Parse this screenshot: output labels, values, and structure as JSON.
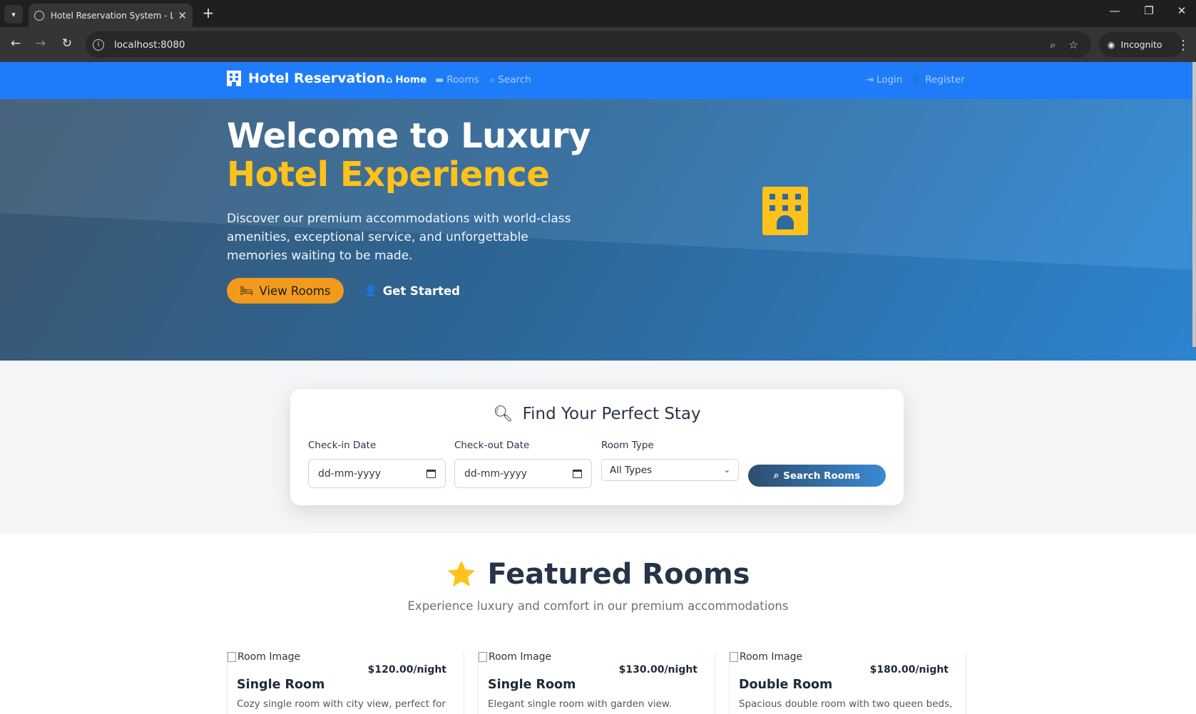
{
  "browser": {
    "tab_title": "Hotel Reservation System - Luxury Hotel Experience",
    "url": "localhost:8080",
    "incognito_label": "Incognito"
  },
  "navbar": {
    "brand": "Hotel Reservation",
    "links": [
      {
        "label": "Home",
        "icon": "home-icon",
        "active": true
      },
      {
        "label": "Rooms",
        "icon": "bed-icon",
        "active": false
      },
      {
        "label": "Search",
        "icon": "search-icon",
        "active": false
      }
    ],
    "auth": [
      {
        "label": "Login",
        "icon": "login-icon"
      },
      {
        "label": "Register",
        "icon": "user-plus-icon"
      }
    ],
    "color": "#1f7cf8"
  },
  "hero": {
    "title_line1": "Welcome to Luxury",
    "title_line2": "Hotel Experience",
    "description": "Discover our premium accommodations with world-class amenities, exceptional service, and unforgettable memories waiting to be made.",
    "primary_button": "View Rooms",
    "secondary_button": "Get Started",
    "accent_color": "#ffc21a",
    "button_color": "#f29a1b"
  },
  "search": {
    "title": "Find Your Perfect Stay",
    "checkin_label": "Check-in Date",
    "checkin_value": "dd-mm-yyyy",
    "checkout_label": "Check-out Date",
    "checkout_value": "dd-mm-yyyy",
    "room_type_label": "Room Type",
    "room_type_value": "All Types",
    "button": "Search Rooms"
  },
  "featured": {
    "title": "Featured Rooms",
    "subtitle": "Experience luxury and comfort in our premium accommodations",
    "rooms": [
      {
        "image_alt": "Room Image",
        "name": "Single Room",
        "price": "$120.00/night",
        "description": "Cozy single room with city view, perfect for business travelers. Features a comfortable"
      },
      {
        "image_alt": "Room Image",
        "name": "Single Room",
        "price": "$130.00/night",
        "description": "Elegant single room with garden view. Includes premium bedding, spacious bathroom, and"
      },
      {
        "image_alt": "Room Image",
        "name": "Double Room",
        "price": "$180.00/night",
        "description": "Spacious double room with two queen beds, ideal for families or groups. Features modern"
      }
    ]
  }
}
